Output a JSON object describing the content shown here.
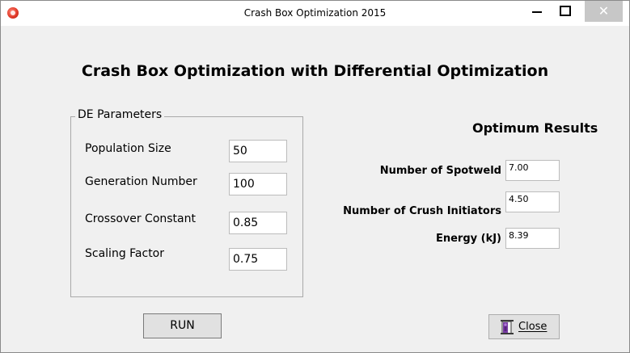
{
  "window": {
    "title": "Crash Box Optimization 2015",
    "close_glyph": "✕"
  },
  "main": {
    "heading": "Crash Box Optimization with Differential Optimization"
  },
  "de_parameters": {
    "legend": "DE Parameters",
    "population_size": {
      "label": "Population Size",
      "value": "50"
    },
    "generation_number": {
      "label": "Generation Number",
      "value": "100"
    },
    "crossover_constant": {
      "label": "Crossover Constant",
      "value": "0.85"
    },
    "scaling_factor": {
      "label": "Scaling Factor",
      "value": "0.75"
    }
  },
  "results": {
    "title": "Optimum Results",
    "spotweld": {
      "label": "Number of Spotweld",
      "value": "7.00"
    },
    "crush_initiators": {
      "label": "Number of Crush Initiators",
      "value": "4.50"
    },
    "energy": {
      "label": "Energy (kJ)",
      "value": "8.39"
    }
  },
  "buttons": {
    "run_label": "RUN",
    "close_label": "Close",
    "close_icon": "door-exit-icon"
  },
  "colors": {
    "titlebar": "#ffffff",
    "client": "#f0f0f0",
    "close_hover": "#c7c7c7",
    "app_icon": "#e23b2a"
  }
}
